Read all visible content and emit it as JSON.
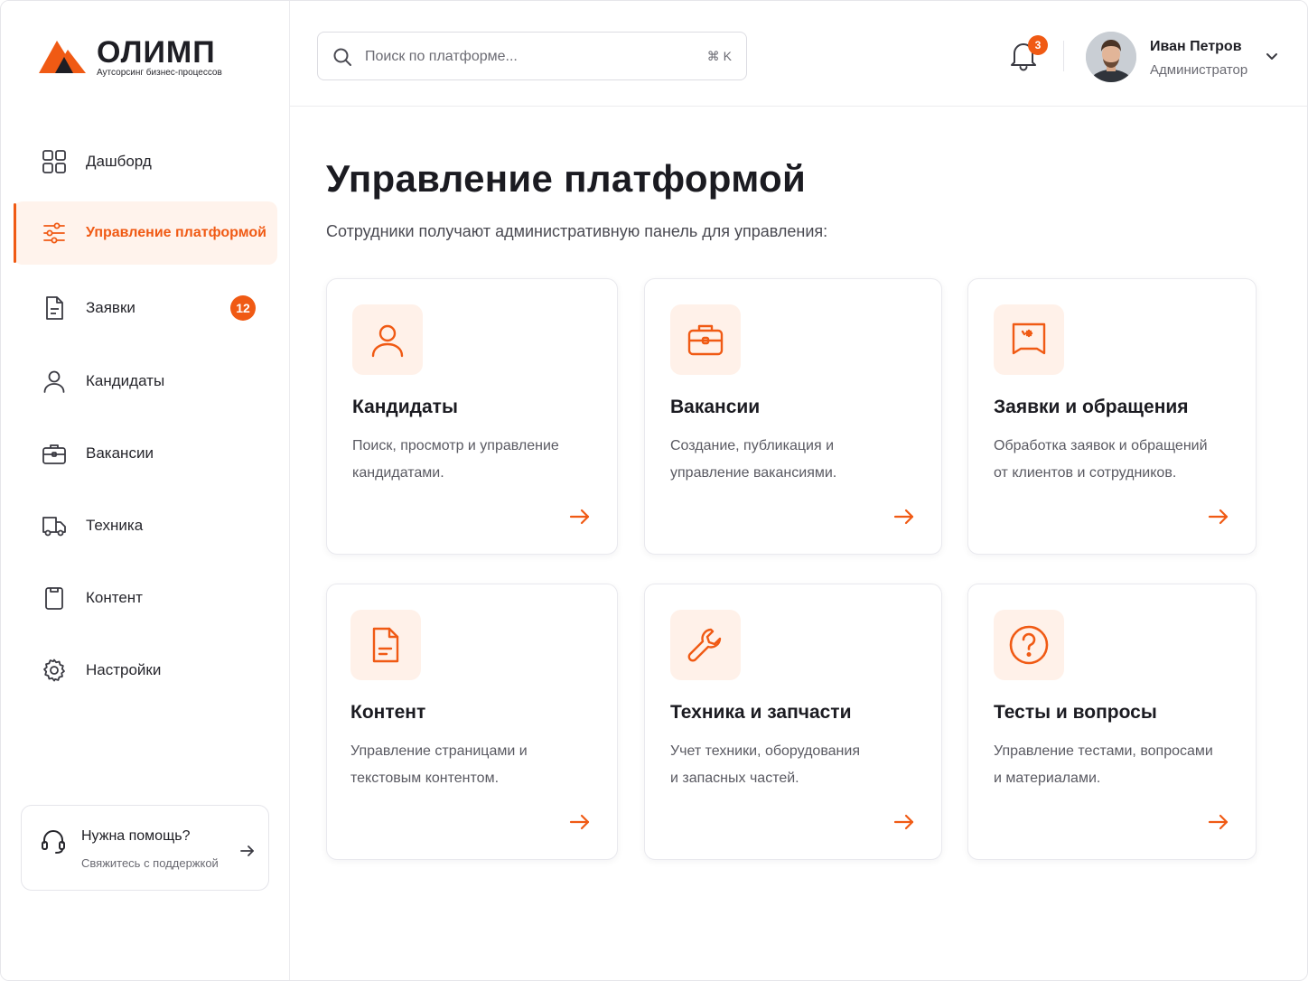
{
  "brand": {
    "name": "ОЛИМП",
    "tagline": "Аутсорсинг бизнес-процессов",
    "accent": "#f05a14"
  },
  "sidebar": {
    "items": [
      {
        "label": "Дашборд",
        "icon": "dashboard-grid-icon",
        "active": false
      },
      {
        "label": "Управление платформой",
        "icon": "sliders-icon",
        "active": true
      },
      {
        "label": "Заявки",
        "icon": "document-icon",
        "badge": "12"
      },
      {
        "label": "Кандидаты",
        "icon": "user-icon"
      },
      {
        "label": "Вакансии",
        "icon": "briefcase-icon"
      },
      {
        "label": "Техника",
        "icon": "truck-icon"
      },
      {
        "label": "Контент",
        "icon": "clipboard-icon"
      },
      {
        "label": "Настройки",
        "icon": "gear-icon"
      }
    ],
    "help": {
      "title": "Нужна помощь?",
      "subtitle": "Свяжитесь с поддержкой"
    }
  },
  "header": {
    "search": {
      "placeholder": "Поиск по платформе...",
      "shortcut": "⌘ K"
    },
    "notifications_count": "3",
    "user": {
      "name": "Иван Петров",
      "role": "Администратор"
    }
  },
  "main": {
    "title": "Управление платформой",
    "subtitle": "Сотрудники получают административную панель для управления:",
    "cards": [
      {
        "title": "Кандидаты",
        "desc_line1": "Поиск, просмотр и управление",
        "desc_line2": "кандидатами.",
        "icon": "user-icon"
      },
      {
        "title": "Вакансии",
        "desc_line1": "Создание, публикация и",
        "desc_line2": "управление вакансиями.",
        "icon": "briefcase-icon"
      },
      {
        "title": "Заявки и обращения",
        "desc_line1": "Обработка заявок и обращений",
        "desc_line2": "от клиентов и сотрудников.",
        "icon": "message-board-icon"
      },
      {
        "title": "Контент",
        "desc_line1": "Управление страницами и",
        "desc_line2": "текстовым контентом.",
        "icon": "document-icon"
      },
      {
        "title": "Техника и запчасти",
        "desc_line1": "Учет техники, оборудования",
        "desc_line2": "и запасных частей.",
        "icon": "wrench-icon"
      },
      {
        "title": "Тесты и вопросы",
        "desc_line1": "Управление тестами, вопросами",
        "desc_line2": "и материалами.",
        "icon": "question-circle-icon"
      }
    ]
  }
}
